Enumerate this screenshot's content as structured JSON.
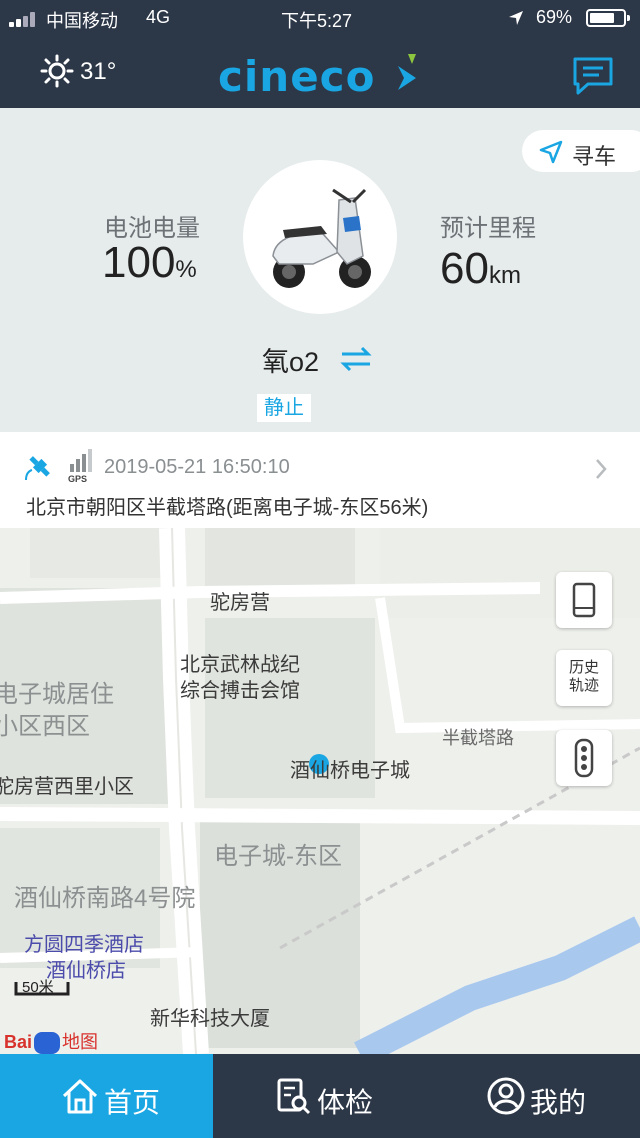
{
  "status_bar": {
    "carrier": "中国移动",
    "network": "4G",
    "time": "下午5:27",
    "battery_percent": "69%"
  },
  "header": {
    "weather_icon": "sun-icon",
    "temperature": "31°",
    "logo_text": "cineco",
    "message_icon": "chat-bubble-icon"
  },
  "vehicle": {
    "find_car_label": "寻车",
    "battery_label": "电池电量",
    "battery_value": "100",
    "battery_unit": "%",
    "range_label": "预计里程",
    "range_value": "60",
    "range_unit": "km",
    "name": "氧o2",
    "state": "静止"
  },
  "location": {
    "gps_label": "GPS",
    "timestamp": "2019-05-21 16:50:10",
    "address": "北京市朝阳区半截塔路(距离电子城-东区56米)"
  },
  "map": {
    "labels": {
      "tuofangying": "驼房营",
      "wulin_1": "北京武林战纪",
      "wulin_2": "综合搏击会馆",
      "dzc_jz_1": "电子城居住",
      "dzc_jz_2": "小区西区",
      "tuofangying_xili": "驼房营西里小区",
      "jxq_dzc": "酒仙桥电子城",
      "banjieta_road": "半截塔路",
      "dzc_east": "电子城-东区",
      "jxq_nanlu": "酒仙桥南路4号院",
      "hotel_1": "方圆四季酒店",
      "hotel_2": "酒仙桥店",
      "xinhua": "新华科技大厦"
    },
    "scale_label": "50米",
    "history_label": "历史\n轨迹",
    "baidu_logo": "Bai",
    "baidu_map": "地图",
    "accent_color": "#19a6e3"
  },
  "tabs": [
    {
      "label": "首页",
      "icon": "home-icon",
      "active": true
    },
    {
      "label": "体检",
      "icon": "checkup-icon",
      "active": false
    },
    {
      "label": "我的",
      "icon": "user-icon",
      "active": false
    }
  ]
}
